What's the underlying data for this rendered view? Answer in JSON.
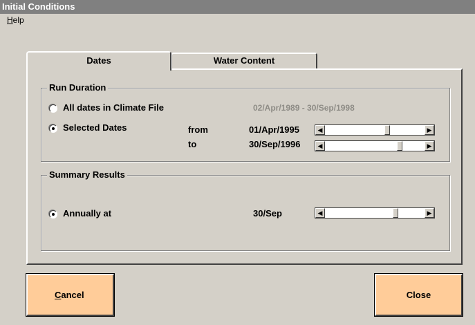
{
  "window": {
    "title": "Initial Conditions"
  },
  "menu": {
    "help_first": "H",
    "help_rest": "elp"
  },
  "tabs": [
    {
      "label": "Dates",
      "active": true
    },
    {
      "label": "Water Content",
      "active": false
    }
  ],
  "run_duration": {
    "title": "Run Duration",
    "all_dates_label": "All dates in Climate File",
    "all_dates_range": "02/Apr/1989 - 30/Sep/1998",
    "selected_dates_label": "Selected Dates",
    "from_label": "from",
    "from_value": "01/Apr/1995",
    "to_label": "to",
    "to_value": "30/Sep/1996",
    "selected_option": "selected_dates",
    "from_slider_position": 0.62,
    "to_slider_position": 0.73
  },
  "summary_results": {
    "title": "Summary Results",
    "annually_label": "Annually at",
    "annually_value": "30/Sep",
    "selected_option": "annually",
    "annual_slider_position": 0.73
  },
  "buttons": {
    "cancel_first": "C",
    "cancel_rest": "ancel",
    "close": "Close"
  },
  "icons": {
    "scroll_left": "◀",
    "scroll_right": "▶"
  },
  "colors": {
    "button_accent": "#ffcc99",
    "title_bar": "#808080",
    "face": "#d4d0c8"
  }
}
